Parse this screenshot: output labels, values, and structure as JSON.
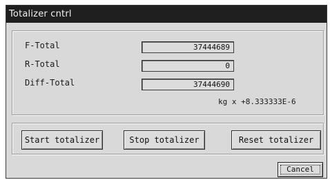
{
  "window": {
    "title": "Totalizer cntrl"
  },
  "totals": {
    "f_total": {
      "label": "F-Total",
      "value": "37444689"
    },
    "r_total": {
      "label": "R-Total",
      "value": "0"
    },
    "diff_total": {
      "label": "Diff-Total",
      "value": "37444690"
    },
    "units": "kg x +8.333333E-6"
  },
  "buttons": {
    "start": "Start totalizer",
    "stop": "Stop totalizer",
    "reset": "Reset totalizer",
    "cancel": "Cancel"
  }
}
